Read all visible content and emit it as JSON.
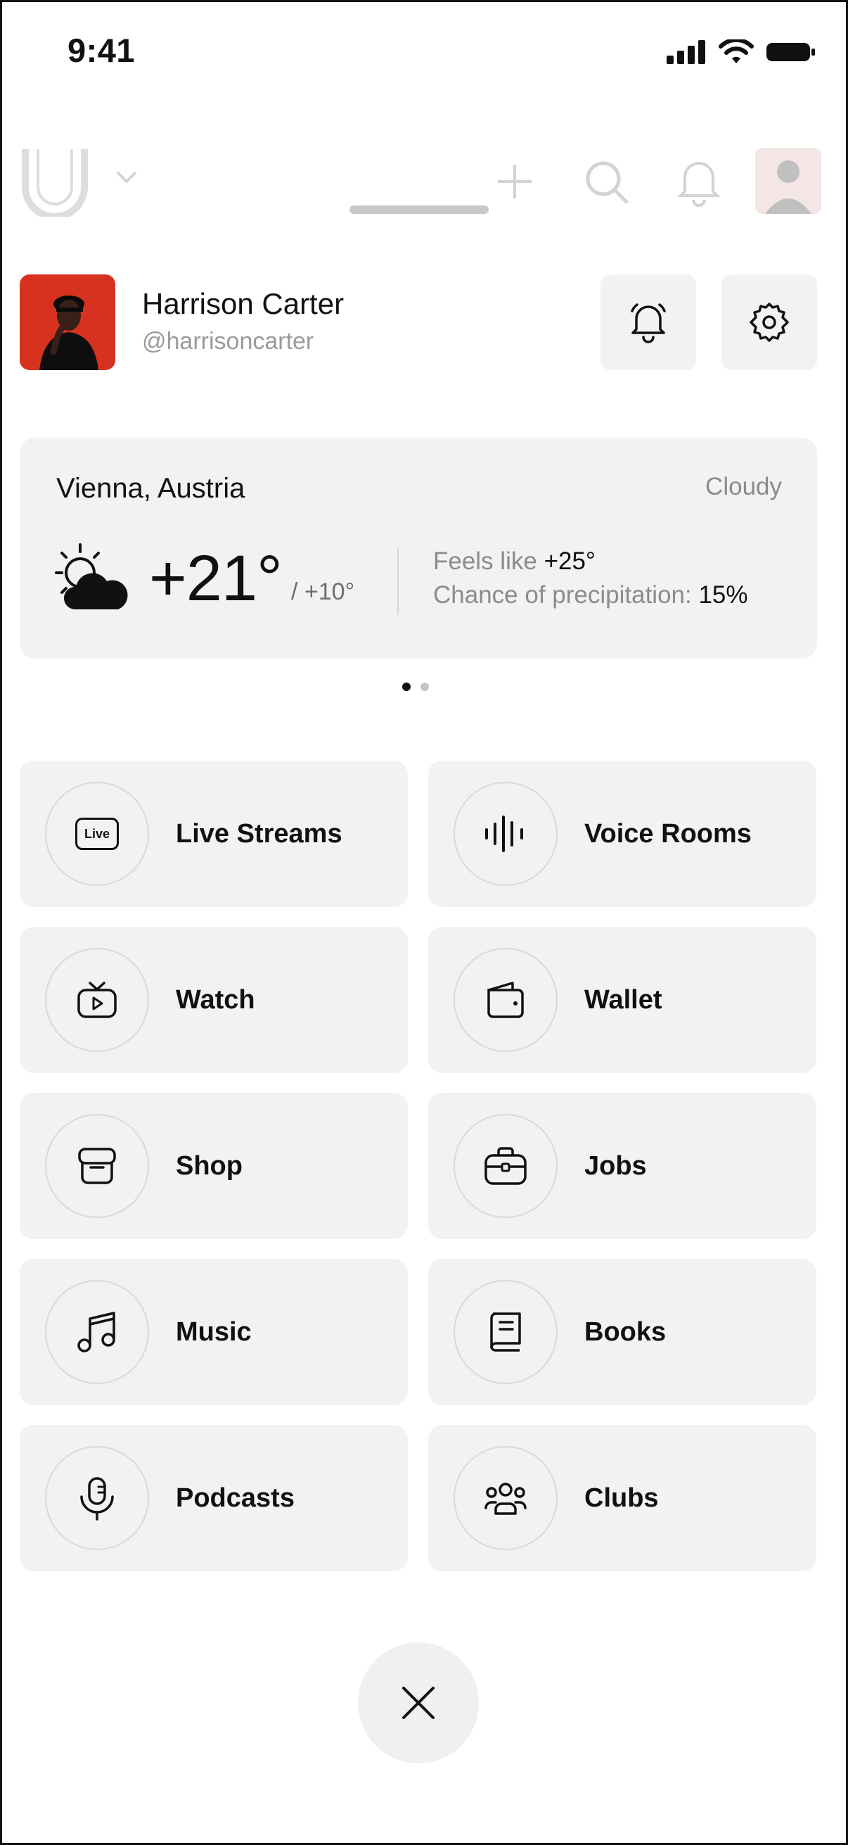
{
  "status_bar": {
    "time": "9:41"
  },
  "profile": {
    "name": "Harrison Carter",
    "handle": "@harrisoncarter"
  },
  "weather": {
    "location": "Vienna, Austria",
    "condition": "Cloudy",
    "temperature": "+21°",
    "low": "/ +10°",
    "feels_like_label": "Feels like",
    "feels_like_value": "+25°",
    "precip_label": "Chance of precipitation:",
    "precip_value": "15%",
    "icon": "sun-cloud-icon"
  },
  "pager": {
    "pages": 2,
    "active": 1
  },
  "menu": [
    {
      "label": "Live Streams",
      "icon": "live-icon",
      "icon_text": "Live"
    },
    {
      "label": "Voice Rooms",
      "icon": "soundwave-icon"
    },
    {
      "label": "Watch",
      "icon": "tv-icon"
    },
    {
      "label": "Wallet",
      "icon": "wallet-icon"
    },
    {
      "label": "Shop",
      "icon": "shop-icon"
    },
    {
      "label": "Jobs",
      "icon": "briefcase-icon"
    },
    {
      "label": "Music",
      "icon": "music-note-icon"
    },
    {
      "label": "Books",
      "icon": "book-icon"
    },
    {
      "label": "Podcasts",
      "icon": "microphone-icon"
    },
    {
      "label": "Clubs",
      "icon": "group-icon"
    }
  ]
}
